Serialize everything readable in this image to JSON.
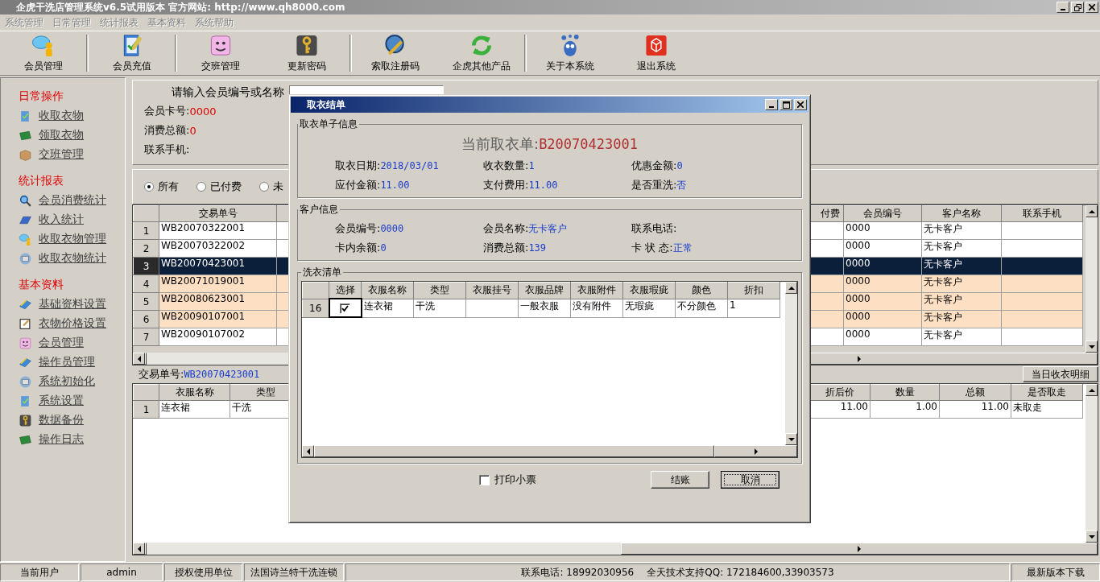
{
  "window": {
    "title": "企虎干洗店管理系统v6.5试用版本 官方网站: http://www.qh8000.com"
  },
  "menu": [
    {
      "label": "系统管理",
      "disabled": true
    },
    {
      "label": "日常管理",
      "disabled": true
    },
    {
      "label": "统计报表",
      "disabled": true
    },
    {
      "label": "基本资料",
      "disabled": true
    },
    {
      "label": "系统帮助",
      "disabled": true
    }
  ],
  "toolbar": [
    {
      "items": [
        "会员管理"
      ]
    },
    {
      "items": [
        "会员充值"
      ]
    },
    {
      "items": [
        "交班管理",
        "更新密码"
      ]
    },
    {
      "items": [
        "索取注册码",
        "企虎其他产品"
      ]
    },
    {
      "items": [
        "关于本系统",
        "退出系统"
      ]
    }
  ],
  "sidebar": [
    {
      "heading": "日常操作",
      "items": [
        "收取衣物",
        "领取衣物",
        "交班管理"
      ]
    },
    {
      "heading": "统计报表",
      "items": [
        "会员消费统计",
        "收入统计",
        "收取衣物管理",
        "收取衣物统计"
      ]
    },
    {
      "heading": "基本资料",
      "items": [
        "基础资料设置",
        "衣物价格设置",
        "会员管理",
        "操作员管理",
        "系统初始化",
        "系统设置",
        "数据备份",
        "操作日志"
      ]
    }
  ],
  "member_panel": {
    "prompt": "请输入会员编号或名称",
    "fields": [
      {
        "label": "会员卡号:",
        "value": "0000"
      },
      {
        "label": "消费总额:",
        "value": "0"
      },
      {
        "label": "联系手机:"
      }
    ]
  },
  "filters": [
    {
      "label": "所有",
      "selected": true
    },
    {
      "label": "已付费",
      "selected": false
    },
    {
      "label": "未",
      "selected": false
    }
  ],
  "orders": {
    "columns": [
      "交易单号",
      "付费",
      "会员编号",
      "客户名称",
      "联系手机"
    ],
    "rows": [
      {
        "number": "1",
        "order_no": "WB20070322001",
        "member_no": "0000",
        "customer": "无卡客户",
        "selected": false,
        "highlighted": false
      },
      {
        "number": "2",
        "order_no": "WB20070322002",
        "member_no": "0000",
        "customer": "无卡客户",
        "selected": false,
        "highlighted": false
      },
      {
        "number": "3",
        "order_no": "WB20070423001",
        "member_no": "0000",
        "customer": "无卡客户",
        "selected": true,
        "highlighted": false
      },
      {
        "number": "4",
        "order_no": "WB20071019001",
        "member_no": "0000",
        "customer": "无卡客户",
        "selected": false,
        "highlighted": true
      },
      {
        "number": "5",
        "order_no": "WB20080623001",
        "member_no": "0000",
        "customer": "无卡客户",
        "selected": false,
        "highlighted": true
      },
      {
        "number": "6",
        "order_no": "WB20090107001",
        "member_no": "0000",
        "customer": "无卡客户",
        "selected": false,
        "highlighted": true
      },
      {
        "number": "7",
        "order_no": "WB20090107002",
        "member_no": "0000",
        "customer": "无卡客户",
        "selected": false,
        "highlighted": false
      }
    ]
  },
  "detail": {
    "label": "交易单号:",
    "order_no": "WB20070423001",
    "button": "当日收衣明细",
    "columns_left": [
      "衣服名称",
      "类型"
    ],
    "columns_right": [
      "折后价",
      "数量",
      "总额",
      "是否取走"
    ],
    "rows": [
      {
        "number": "1",
        "name": "连衣裙",
        "type": "干洗",
        "discounted_price": "11.00",
        "quantity": "1.00",
        "total": "11.00",
        "status": "未取走"
      }
    ]
  },
  "dialog": {
    "title": "取衣结单",
    "order_group": {
      "title": "取衣单子信息",
      "current_label": "当前取衣单:",
      "current_value": "B20070423001",
      "fields": [
        {
          "label": "取衣日期:",
          "value": "2018/03/01"
        },
        {
          "label": "收衣数量:",
          "value": "1"
        },
        {
          "label": "优惠金额:",
          "value": "0"
        },
        {
          "label": "应付金额:",
          "value": "11.00"
        },
        {
          "label": "支付费用:",
          "value": "11.00"
        },
        {
          "label": "是否重洗:",
          "value": "否"
        }
      ]
    },
    "customer_group": {
      "title": "客户信息",
      "fields": [
        {
          "label": "会员编号:",
          "value": "0000"
        },
        {
          "label": "会员名称:",
          "value": "无卡客户"
        },
        {
          "label": "联系电话:"
        },
        {
          "label": "卡内余额:",
          "value": "0"
        },
        {
          "label": "消费总额:",
          "value": "139"
        },
        {
          "label": "卡 状 态:",
          "value": "正常"
        }
      ]
    },
    "laundry_group": {
      "title": "洗衣清单",
      "columns": [
        "选择",
        "衣服名称",
        "类型",
        "衣服挂号",
        "衣服品牌",
        "衣服附件",
        "衣服瑕疵",
        "颜色",
        "折扣"
      ],
      "rows": [
        {
          "number": "16",
          "checked": true,
          "name": "连衣裙",
          "type": "干洗",
          "brand": "一般衣服",
          "accessory": "没有附件",
          "defect": "无瑕疵",
          "garment_color": "不分颜色",
          "discount": "1"
        }
      ]
    },
    "print_receipt": {
      "label": "打印小票",
      "checked": false
    },
    "buttons": [
      {
        "label": "结账",
        "focused": false
      },
      {
        "label": "取消",
        "focused": true
      }
    ]
  },
  "status_bar": {
    "left": [
      "当前用户",
      "admin",
      "授权使用单位",
      "法国诗兰特干洗连锁"
    ],
    "center": [
      "联系电话: 18992030956",
      "全天技术支持QQ: 172184600,33903573"
    ],
    "right": "最新版本下载"
  }
}
